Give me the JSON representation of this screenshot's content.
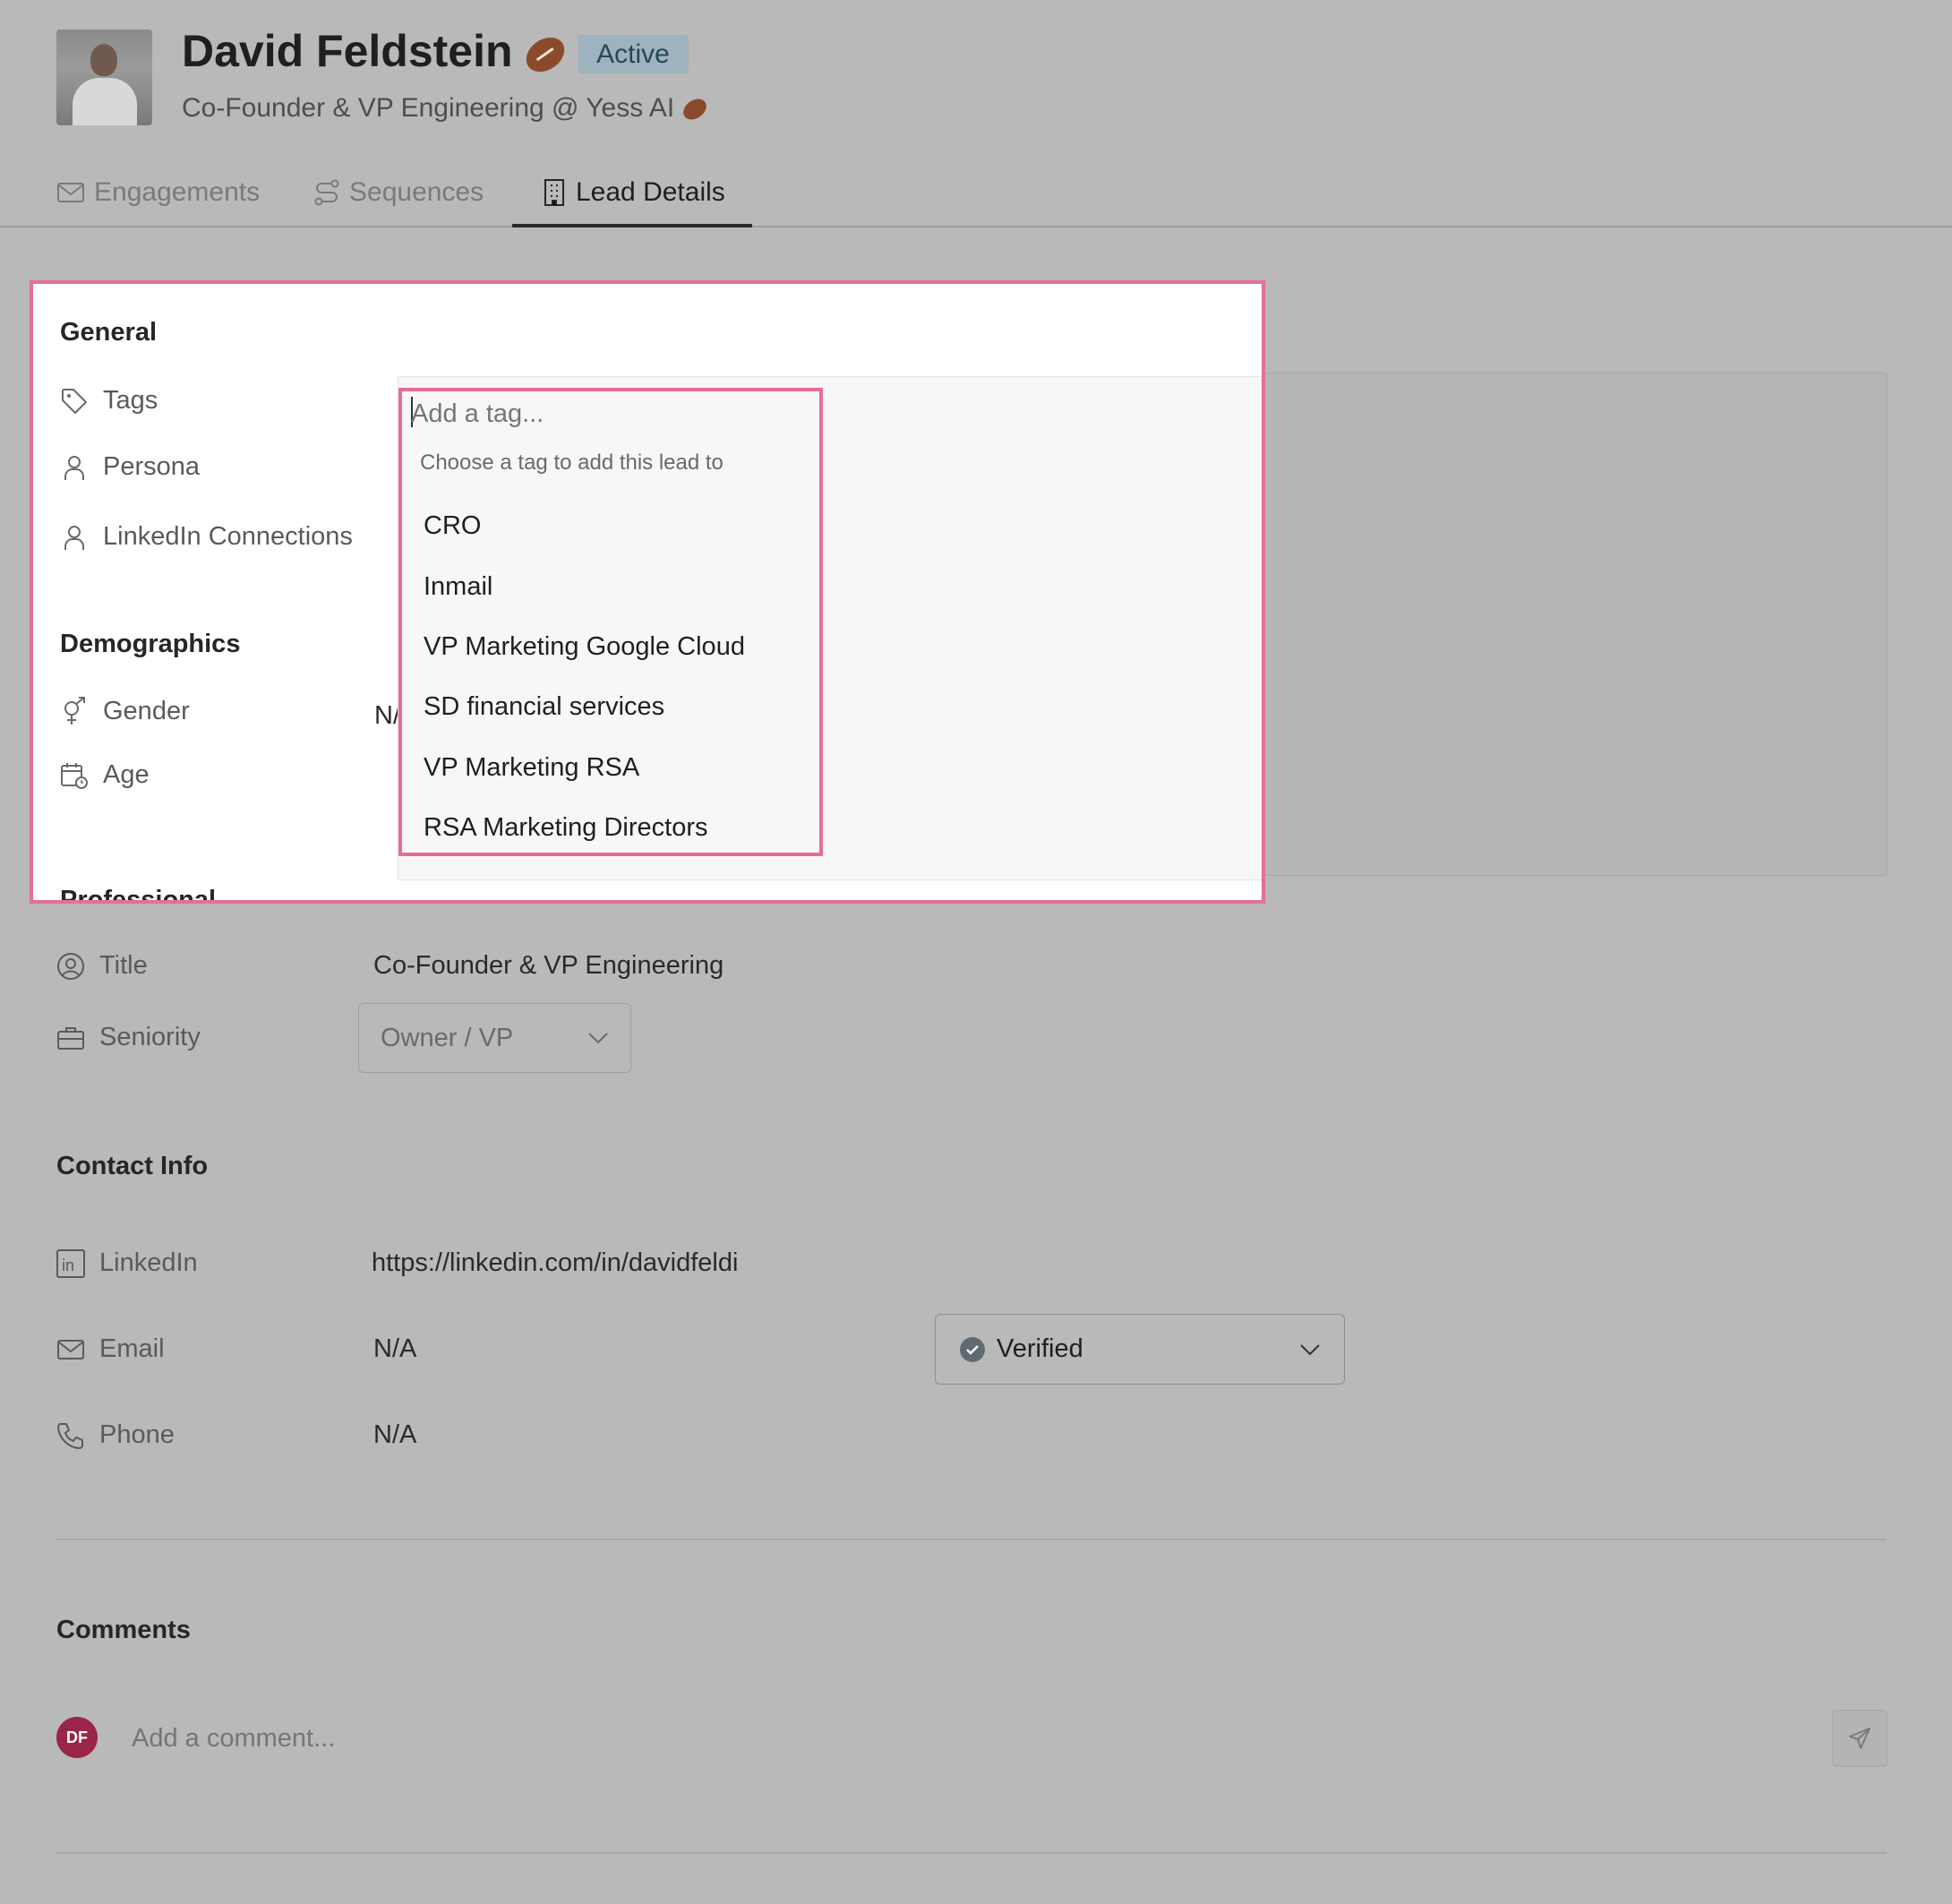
{
  "profile": {
    "name": "David Feldstein",
    "status": "Active",
    "subtitle": "Co-Founder & VP Engineering @ Yess AI"
  },
  "tabs": [
    {
      "label": "Engagements",
      "icon": "mail-icon"
    },
    {
      "label": "Sequences",
      "icon": "route-icon"
    },
    {
      "label": "Lead Details",
      "icon": "building-icon",
      "active": true
    }
  ],
  "general": {
    "title": "General",
    "tags_label": "Tags",
    "persona_label": "Persona",
    "linkedin_connections_label": "LinkedIn Connections"
  },
  "tag_dropdown": {
    "placeholder": "Add a tag...",
    "hint": "Choose a tag to add this lead to",
    "options": [
      "CRO",
      "Inmail",
      "VP Marketing Google Cloud",
      "SD financial services",
      "VP Marketing RSA",
      "RSA Marketing Directors"
    ]
  },
  "demographics": {
    "title": "Demographics",
    "gender_label": "Gender",
    "gender_value": "N/",
    "age_label": "Age"
  },
  "professional": {
    "title": "Professional",
    "title_label": "Title",
    "title_value": "Co-Founder & VP Engineering",
    "seniority_label": "Seniority",
    "seniority_value": "Owner / VP"
  },
  "contact": {
    "title": "Contact Info",
    "linkedin_label": "LinkedIn",
    "linkedin_value": "https://linkedin.com/in/davidfeldi",
    "email_label": "Email",
    "email_value": "N/A",
    "email_status": "Verified",
    "phone_label": "Phone",
    "phone_value": "N/A"
  },
  "comments": {
    "title": "Comments",
    "avatar_initials": "DF",
    "placeholder": "Add a comment..."
  },
  "colors": {
    "highlight": "#e66d9b",
    "badge_bg": "#9eb3bd",
    "avatar_bg": "#9b2449"
  }
}
